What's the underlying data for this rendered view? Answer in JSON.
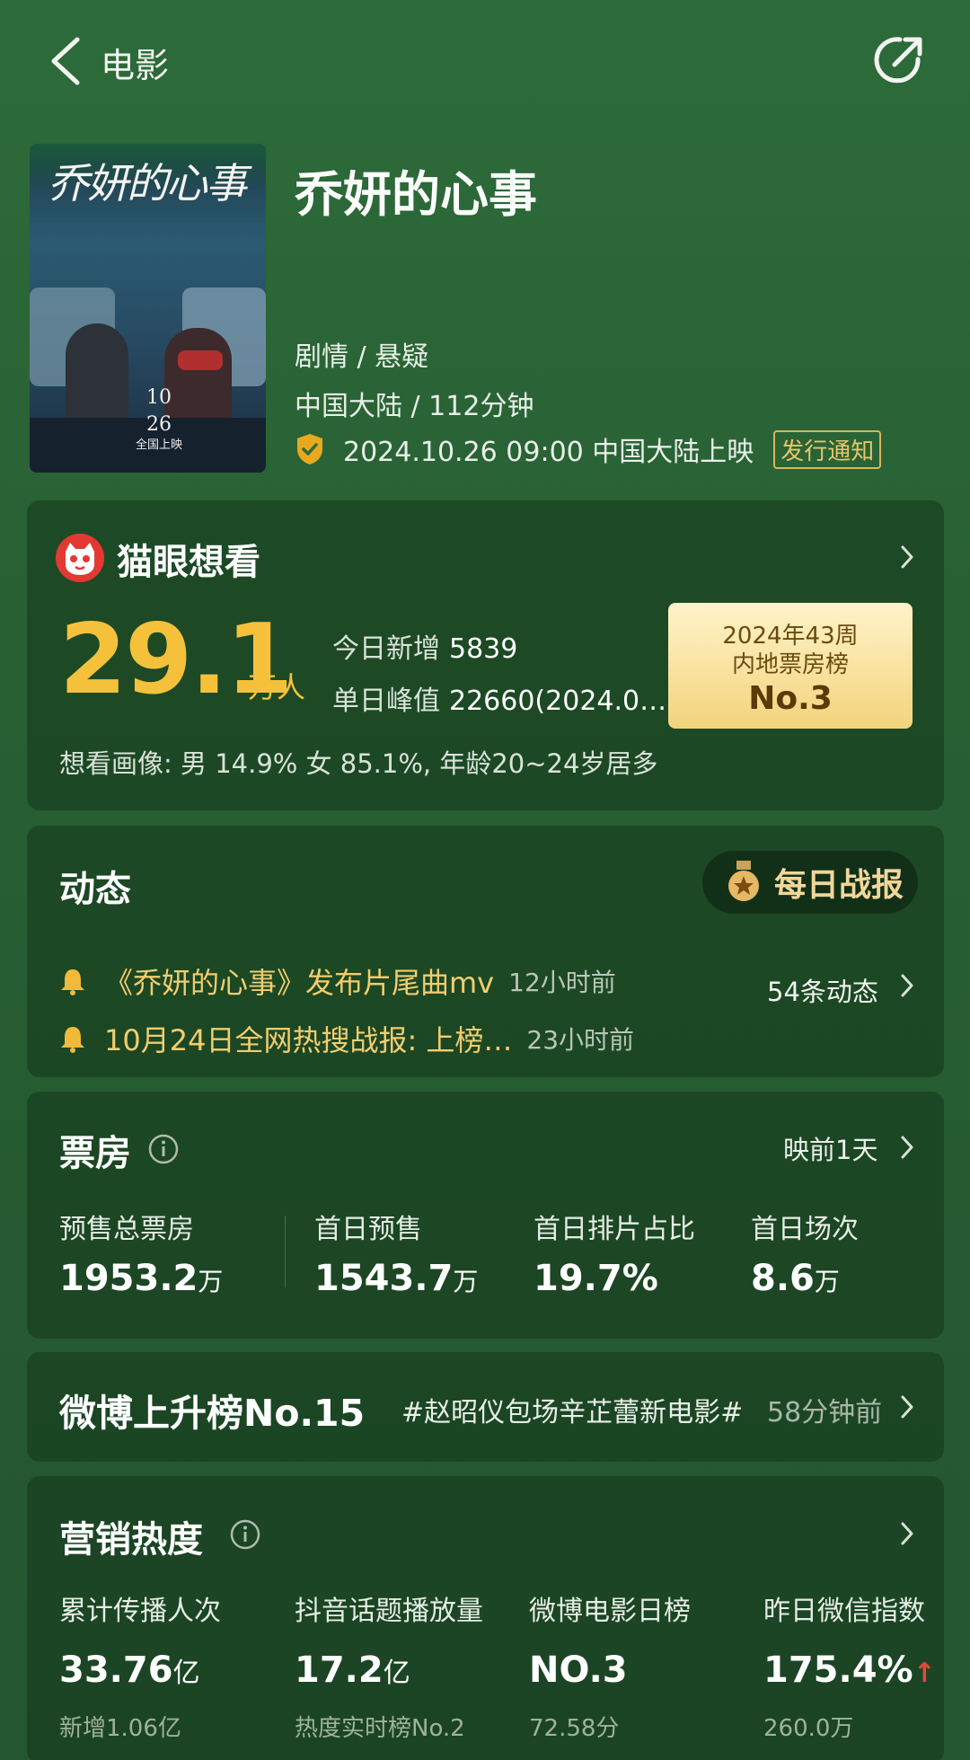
{
  "nav": {
    "title": "电影"
  },
  "movie": {
    "poster_title": "乔妍的心事",
    "poster_date_1": "10",
    "poster_date_2": "26",
    "poster_date_3": "全国上映",
    "title": "乔妍的心事",
    "genre": "剧情 / 悬疑",
    "region_duration": "中国大陆 / 112分钟",
    "release": "2024.10.26 09:00 中国大陆上映",
    "release_badge": "发行通知"
  },
  "maoyan": {
    "title": "猫眼想看",
    "count": "29.1",
    "unit": "万人",
    "today_label": "今日新增",
    "today_value": "5839",
    "peak_label": "单日峰值",
    "peak_value": "22660(2024.0…",
    "rank_line1": "2024年43周",
    "rank_line2": "内地票房榜",
    "rank_no": "No.3",
    "profile": "想看画像:  男 14.9%  女 85.1%,  年龄20~24岁居多"
  },
  "dynamics": {
    "title": "动态",
    "daily_label": "每日战报",
    "news": [
      {
        "text": "《乔妍的心事》发布片尾曲mv",
        "time": "12小时前"
      },
      {
        "text": "10月24日全网热搜战报:  上榜…",
        "time": "23小时前"
      }
    ],
    "count": "54条动态"
  },
  "box_office": {
    "title": "票房",
    "right_label": "映前1天",
    "columns": [
      {
        "label": "预售总票房",
        "value": "1953.2",
        "unit": "万"
      },
      {
        "label": "首日预售",
        "value": "1543.7",
        "unit": "万"
      },
      {
        "label": "首日排片占比",
        "value": "19.7%",
        "unit": ""
      },
      {
        "label": "首日场次",
        "value": "8.6",
        "unit": "万"
      }
    ]
  },
  "weibo": {
    "title": "微博上升榜No.15",
    "tag": "#赵昭仪包场辛芷蕾新电影#",
    "time": "58分钟前"
  },
  "marketing": {
    "title": "营销热度",
    "columns": [
      {
        "label": "累计传播人次",
        "value": "33.76",
        "unit": "亿",
        "sub": "新增1.06亿"
      },
      {
        "label": "抖音话题播放量",
        "value": "17.2",
        "unit": "亿",
        "sub": "热度实时榜No.2"
      },
      {
        "label": "微博电影日榜",
        "value": "NO.3",
        "unit": "",
        "sub": "72.58分"
      },
      {
        "label": "昨日微信指数",
        "value": "175.4%",
        "unit": "↑",
        "sub": "260.0万"
      }
    ]
  },
  "colors": {
    "background": "#2d6b3a",
    "accent_gold": "#f5c13b",
    "news_gold": "#f2cd6e",
    "up_red": "#e5463c"
  }
}
